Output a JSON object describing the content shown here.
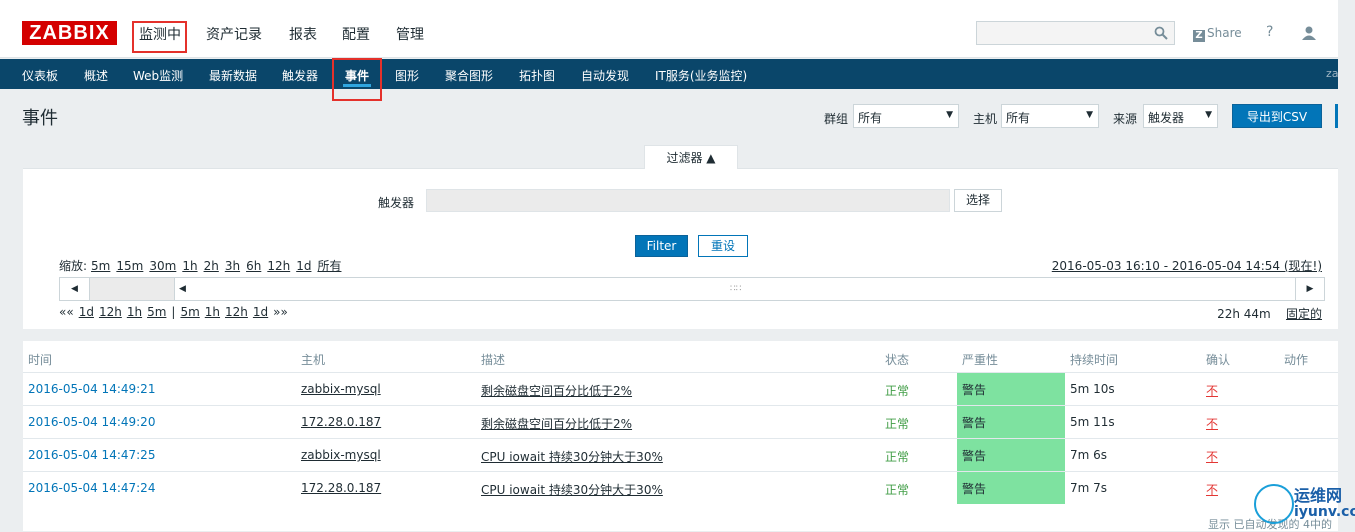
{
  "logo": "ZABBIX",
  "main_menu": [
    "监测中",
    "资产记录",
    "报表",
    "配置",
    "管理"
  ],
  "share": {
    "icon": "Z",
    "label": "Share"
  },
  "help": "?",
  "sub_menu": [
    "仪表板",
    "概述",
    "Web监测",
    "最新数据",
    "触发器",
    "事件",
    "图形",
    "聚合图形",
    "拓扑图",
    "自动发现",
    "IT服务(业务监控)"
  ],
  "sub_menu_active": "事件",
  "subbar_user": "za",
  "page_title": "事件",
  "filters": {
    "group_label": "群组",
    "group_value": "所有",
    "host_label": "主机",
    "host_value": "所有",
    "source_label": "来源",
    "source_value": "触发器"
  },
  "export_button": "导出到CSV",
  "filter_tab": "过滤器 ▲",
  "trigger_label": "触发器",
  "trigger_value": "",
  "choose_button": "选择",
  "filter_button": "Filter",
  "reset_button": "重设",
  "zoom": {
    "label": "缩放:",
    "options": [
      "5m",
      "15m",
      "30m",
      "1h",
      "2h",
      "3h",
      "6h",
      "12h",
      "1d",
      "所有"
    ]
  },
  "period": "2016-05-03 16:10 - 2016-05-04 14:54 (现在!)",
  "nav_back": [
    "««",
    "1d",
    "12h",
    "1h",
    "5m"
  ],
  "nav_sep": "|",
  "nav_fwd": [
    "5m",
    "1h",
    "12h",
    "1d",
    "»»"
  ],
  "duration": "22h 44m",
  "fixed": "固定的",
  "table": {
    "headers": [
      "时间",
      "主机",
      "描述",
      "状态",
      "严重性",
      "持续时间",
      "确认",
      "动作"
    ],
    "rows": [
      {
        "time": "2016-05-04 14:49:21",
        "host": "zabbix-mysql",
        "desc": "剩余磁盘空间百分比低于2%",
        "status": "正常",
        "severity": "警告",
        "duration": "5m 10s",
        "ack": "不"
      },
      {
        "time": "2016-05-04 14:49:20",
        "host": "172.28.0.187",
        "desc": "剩余磁盘空间百分比低于2%",
        "status": "正常",
        "severity": "警告",
        "duration": "5m 11s",
        "ack": "不"
      },
      {
        "time": "2016-05-04 14:47:25",
        "host": "zabbix-mysql",
        "desc": "CPU iowait 持续30分钟大于30%",
        "status": "正常",
        "severity": "警告",
        "duration": "7m 6s",
        "ack": "不"
      },
      {
        "time": "2016-05-04 14:47:24",
        "host": "172.28.0.187",
        "desc": "CPU iowait 持续30分钟大于30%",
        "status": "正常",
        "severity": "警告",
        "duration": "7m 7s",
        "ack": "不"
      }
    ]
  },
  "footer": "显示 已自动发现的 4中的",
  "watermark": {
    "line1": "运维网",
    "line2": "iyunv.com"
  },
  "colors": {
    "accent": "#0275b8",
    "subbar": "#0a466a",
    "warning": "#7ee2a0",
    "ok": "#429e47",
    "no_ack": "#e33734",
    "logo": "#d40000"
  }
}
